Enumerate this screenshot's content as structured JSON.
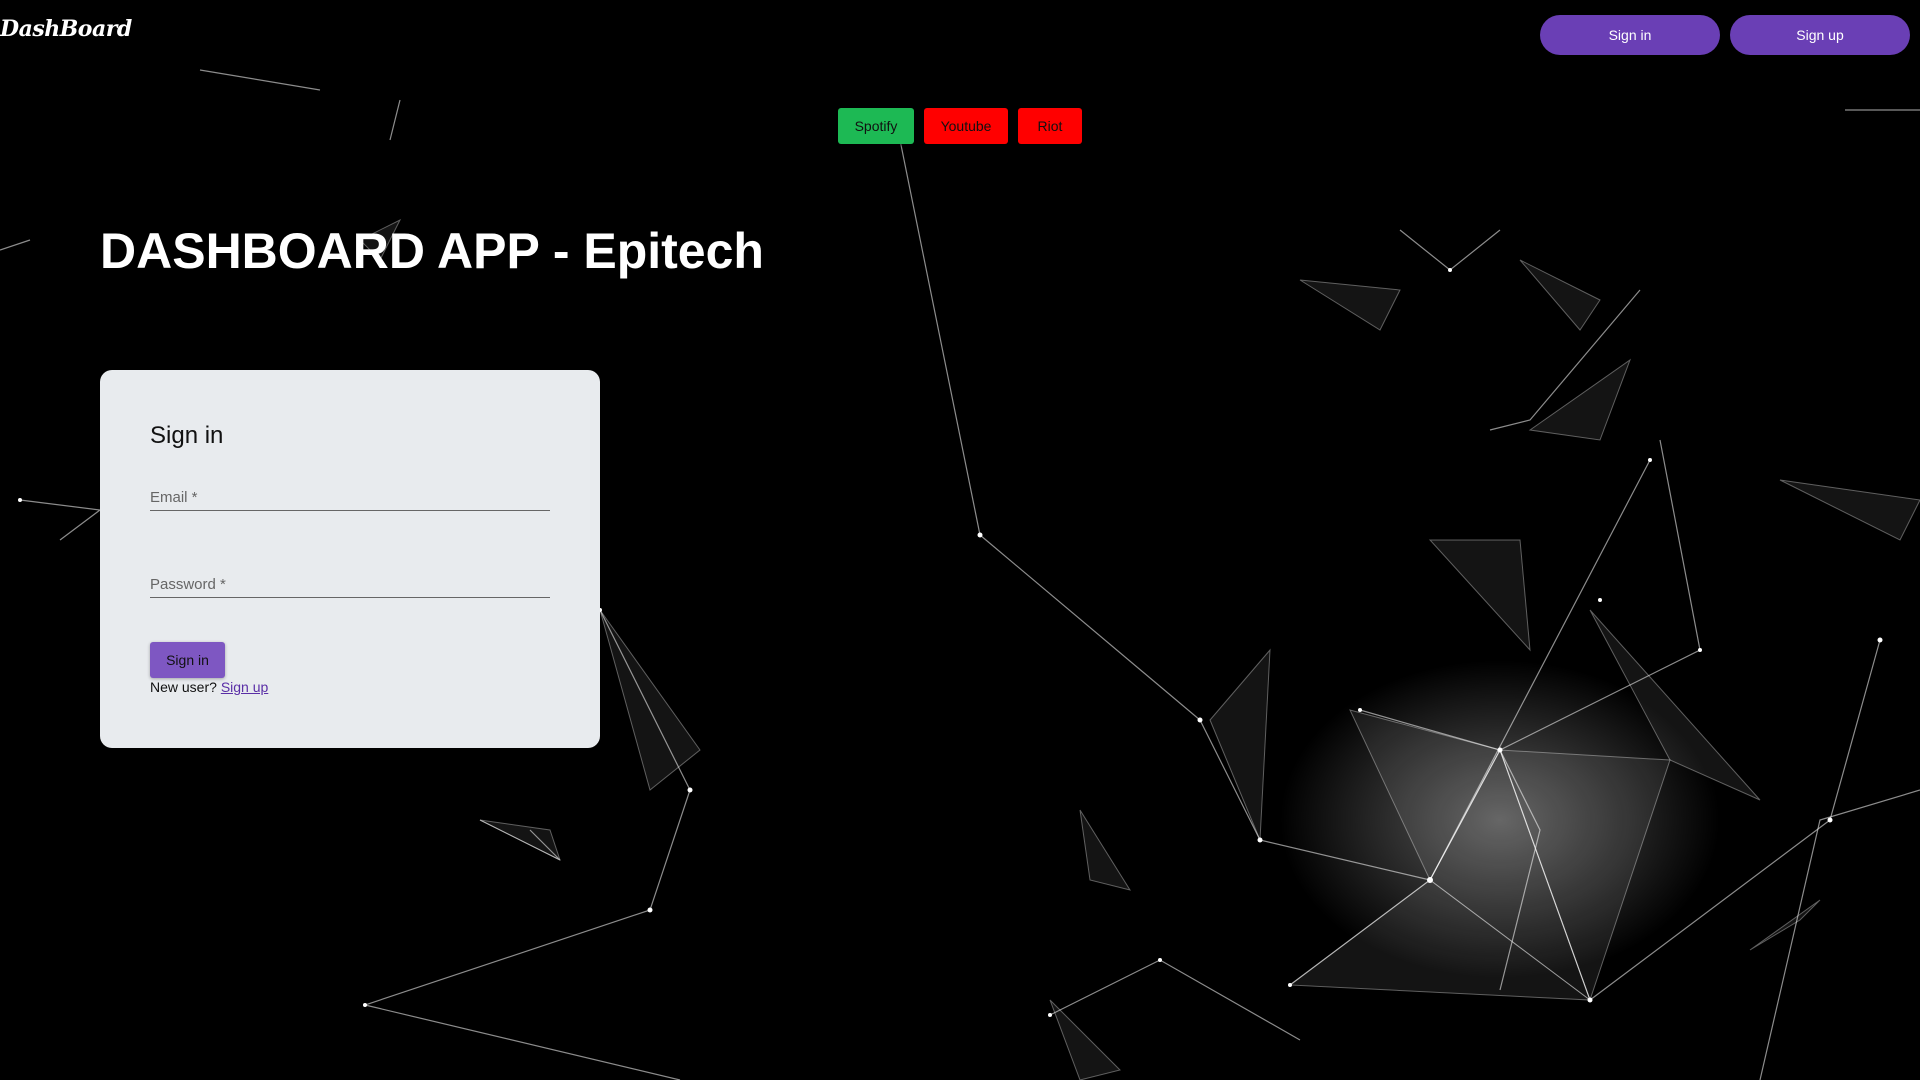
{
  "header": {
    "logo": "DashBoard",
    "signin_label": "Sign in",
    "signup_label": "Sign up"
  },
  "services": [
    {
      "label": "Spotify",
      "color": "#1db954"
    },
    {
      "label": "Youtube",
      "color": "#ff0000"
    },
    {
      "label": "Riot",
      "color": "#ff0000"
    }
  ],
  "hero": {
    "title": "DASHBOARD APP - Epitech"
  },
  "signin_card": {
    "title": "Sign in",
    "email_label": "Email *",
    "password_label": "Password *",
    "submit_label": "Sign in",
    "footer_text": "New user?",
    "footer_link": "Sign up"
  },
  "colors": {
    "accent": "#6a3fb5",
    "card_bg": "#e8ebee",
    "background": "#000000"
  }
}
